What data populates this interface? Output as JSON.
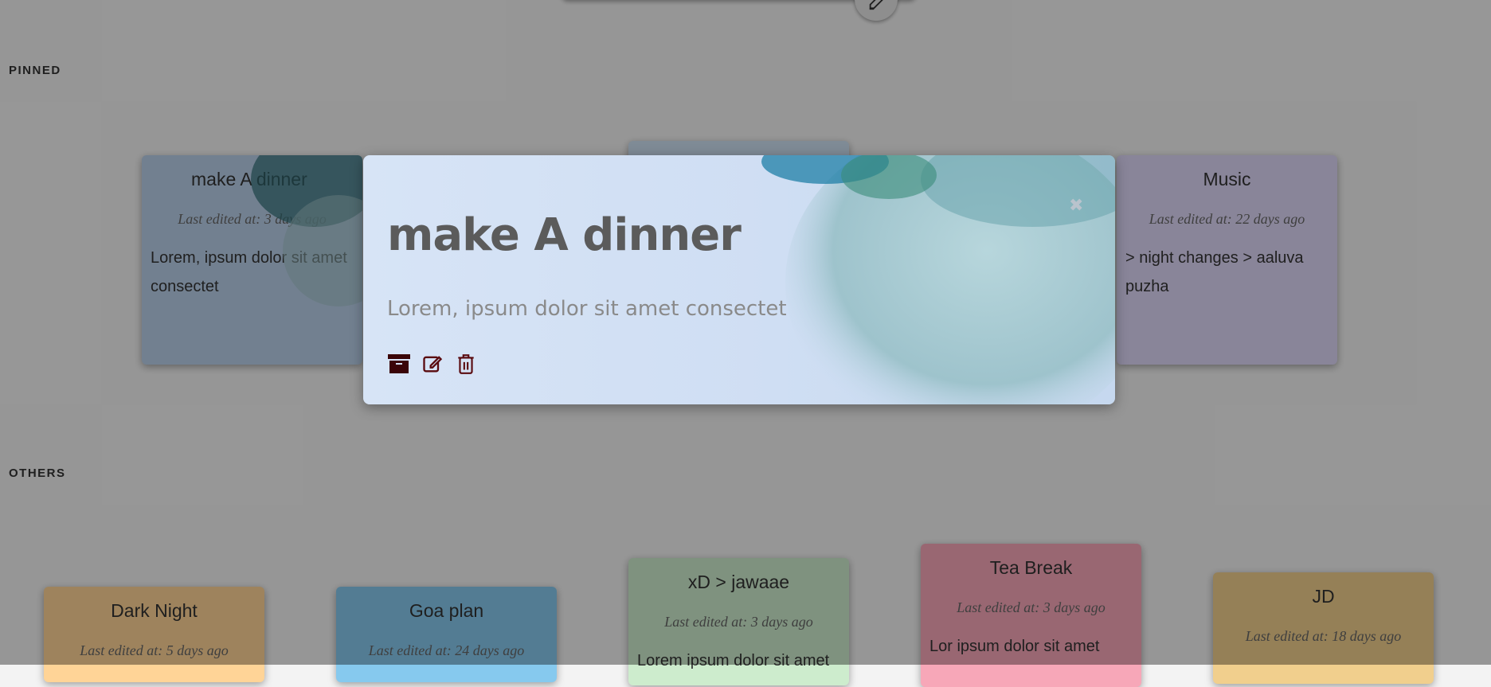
{
  "sections": {
    "pinned_label": "PINNED",
    "others_label": "OTHERS"
  },
  "pinned": [
    {
      "title": "make A dinner",
      "edited": "Last edited at: 3 days ago",
      "body": "Lorem, ipsum dolor sit amet consectet",
      "color": "#b9cfe8"
    },
    {
      "title": "",
      "edited": "",
      "body": "",
      "color": "#cde0f3"
    },
    {
      "title": "Music",
      "edited": "Last edited at: 22 days ago",
      "body": "> night changes > aaluva puzha",
      "color": "#ded7f7"
    }
  ],
  "others": [
    {
      "title": "Dark Night",
      "edited": "Last edited at: 5 days ago",
      "body": "",
      "color": "#ffd497"
    },
    {
      "title": "Goa plan",
      "edited": "Last edited at: 24 days ago",
      "body": "",
      "color": "#86c9ee"
    },
    {
      "title": "xD > jawaae",
      "edited": "Last edited at: 3 days ago",
      "body": "Lorem ipsum dolor sit amet",
      "color": "#cdeccd"
    },
    {
      "title": "Tea Break",
      "edited": "Last edited at: 3 days ago",
      "body": "Lor ipsum dolor sit amet",
      "color": "#f7a7b8"
    },
    {
      "title": "JD",
      "edited": "Last edited at: 18 days ago",
      "body": "",
      "color": "#f1cf8d"
    }
  ],
  "modal": {
    "title": "make A dinner",
    "body": "Lorem, ipsum dolor sit amet consectet",
    "close_glyph": "✖",
    "icons": [
      "archive-icon",
      "edit-icon",
      "trash-icon"
    ],
    "icon_color": "#5a0b10"
  },
  "fab": {
    "icon": "pen-icon"
  }
}
